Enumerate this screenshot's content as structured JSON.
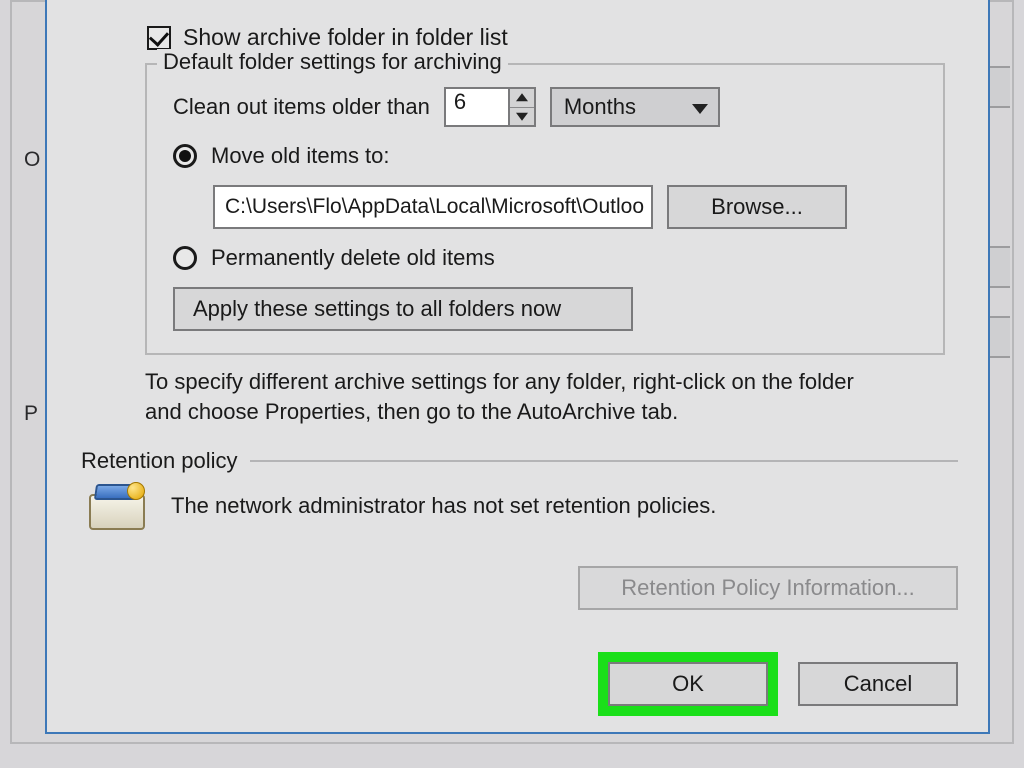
{
  "backdrop": {
    "side_label_1_first": "O",
    "side_label_2_first": "P"
  },
  "archive": {
    "show_archive_checkbox_label": "Show archive folder in folder list",
    "groupbox_title": "Default folder settings for archiving",
    "clean_out_label": "Clean out items older than",
    "clean_out_value": "6",
    "clean_out_unit": "Months",
    "radio_move_label": "Move old items to:",
    "move_path": "C:\\Users\\Flo\\AppData\\Local\\Microsoft\\Outloo",
    "browse_label": "Browse...",
    "radio_delete_label": "Permanently delete old items",
    "apply_all_label": "Apply these settings to all folders now",
    "help_text": "To specify different archive settings for any folder, right-click on the folder and choose Properties, then go to the AutoArchive tab."
  },
  "retention": {
    "section_title": "Retention policy",
    "message": "The network administrator has not set retention policies.",
    "info_button": "Retention Policy Information..."
  },
  "footer": {
    "ok": "OK",
    "cancel": "Cancel"
  }
}
